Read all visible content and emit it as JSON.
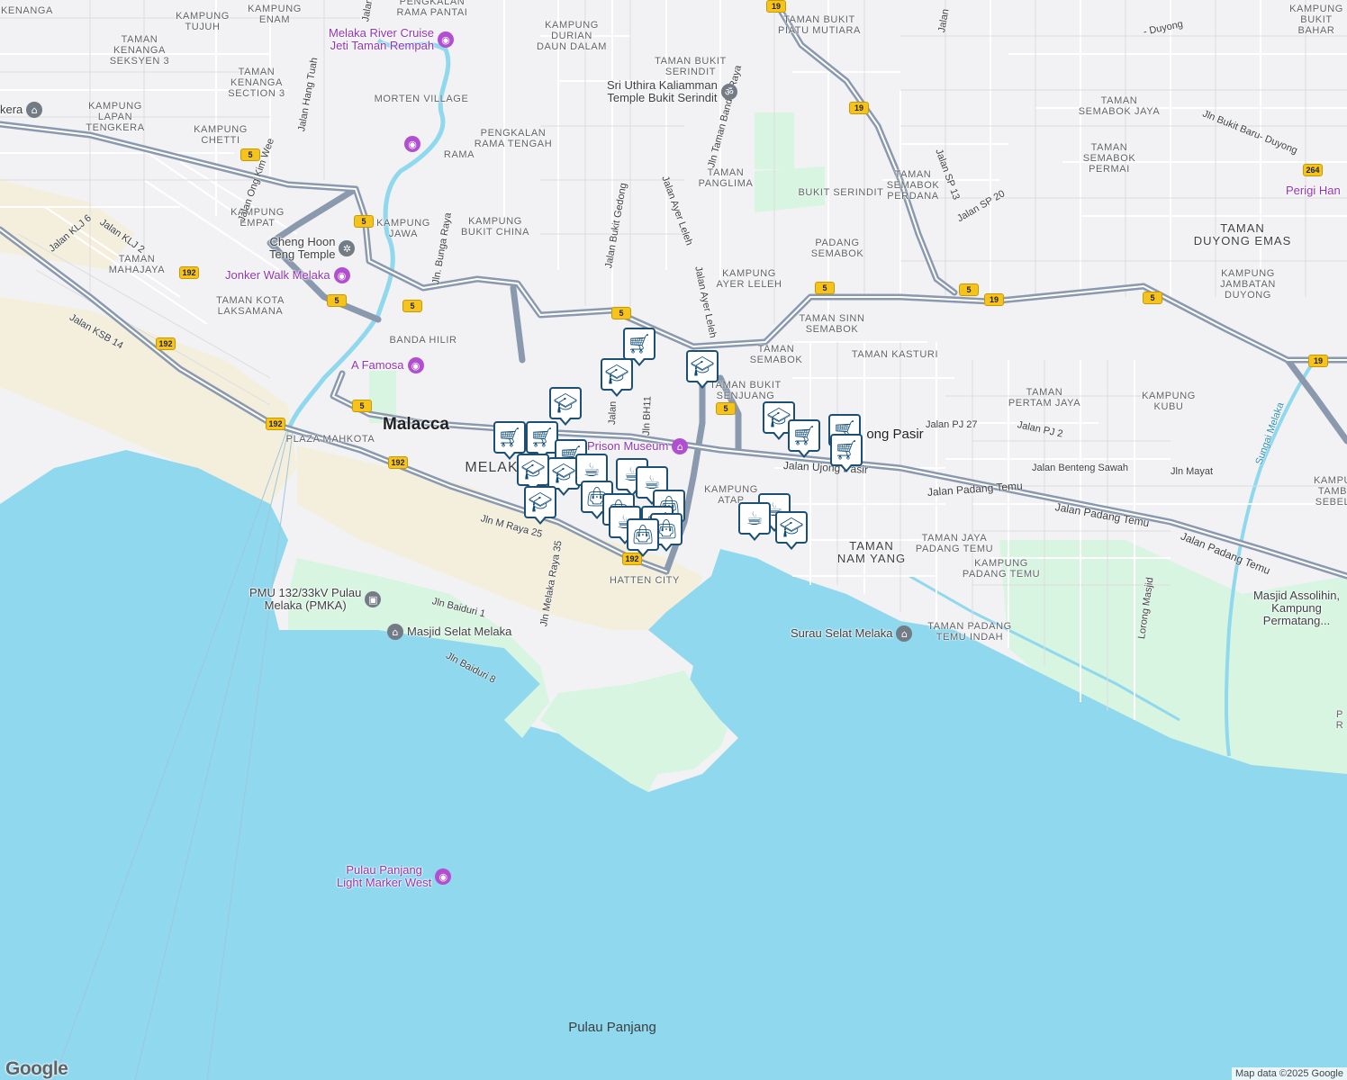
{
  "colors": {
    "water": "#8fd8ee",
    "land": "#f2f2f4",
    "park": "#d8f5e1",
    "sand": "#f4efdd",
    "highway": "#8a99ae",
    "marker_border": "#1d4f73",
    "marker_icon": "#0d4a75",
    "poi_purple": "#9334b6"
  },
  "labels": [
    {
      "id": "kenanga",
      "text": "KENANGA"
    },
    {
      "id": "kampung-tujuh",
      "text": "KAMPUNG\nTUJUH"
    },
    {
      "id": "kampung-enam",
      "text": "KAMPUNG\nENAM"
    },
    {
      "id": "pengkalan-rama-pantai",
      "text": "PENGKALAN\nRAMA PANTAI"
    },
    {
      "id": "taman-kenanga-seksyen-3",
      "text": "TAMAN\nKENANGA\nSEKSYEN 3"
    },
    {
      "id": "taman-kenanga-section-3",
      "text": "TAMAN\nKENANGA\nSECTION 3"
    },
    {
      "id": "kampung-durian-daun-dalam",
      "text": "KAMPUNG\nDURIAN\nDAUN DALAM"
    },
    {
      "id": "taman-bukit-piatu-mutiara",
      "text": "TAMAN BUKIT\nPIATU MUTIARA"
    },
    {
      "id": "kampung-bukit-baharu",
      "text": "KAMPUNG\nBUKIT BAHAR"
    },
    {
      "id": "taman-bukit-serindit",
      "text": "TAMAN BUKIT\nSERINDIT"
    },
    {
      "id": "morten-village",
      "text": "MORTEN VILLAGE"
    },
    {
      "id": "kampung-lapan-tengkera",
      "text": "KAMPUNG\nLAPAN\nTENGKERA"
    },
    {
      "id": "pengkalan-rama-tengah",
      "text": "PENGKALAN\nRAMA TENGAH"
    },
    {
      "id": "rama",
      "text": "RAMA"
    },
    {
      "id": "kampung-chetti",
      "text": "KAMPUNG\nCHETTI"
    },
    {
      "id": "taman-semabok-jaya",
      "text": "TAMAN\nSEMABOK JAYA"
    },
    {
      "id": "taman-semabok-permai",
      "text": "TAMAN\nSEMABOK\nPERMAI"
    },
    {
      "id": "taman-panglima",
      "text": "TAMAN\nPANGLIMA"
    },
    {
      "id": "bukit-serindit",
      "text": "BUKIT SERINDIT"
    },
    {
      "id": "taman-semabok-perdana",
      "text": "TAMAN\nSEMABOK\nPERDANA"
    },
    {
      "id": "kampung-empat",
      "text": "KAMPUNG\nEMPAT"
    },
    {
      "id": "kampung-jawa",
      "text": "KAMPUNG\nJAWA"
    },
    {
      "id": "kampung-bukit-china",
      "text": "KAMPUNG\nBUKIT CHINA"
    },
    {
      "id": "taman-duyong-emas",
      "text": "TAMAN\nDUYONG EMAS"
    },
    {
      "id": "padang-semabok",
      "text": "PADANG\nSEMABOK"
    },
    {
      "id": "taman-mahajaya",
      "text": "TAMAN\nMAHAJAYA"
    },
    {
      "id": "taman-kota-laksamana",
      "text": "TAMAN KOTA\nLAKSAMANA"
    },
    {
      "id": "kampung-ayer-leleh",
      "text": "KAMPUNG\nAYER LELEH"
    },
    {
      "id": "kampung-jambatan-duyong",
      "text": "KAMPUNG\nJAMBATAN\nDUYONG"
    },
    {
      "id": "taman-sinn-semabok",
      "text": "TAMAN SINN\nSEMABOK"
    },
    {
      "id": "banda-hilir",
      "text": "BANDA HILIR"
    },
    {
      "id": "taman-semabok",
      "text": "TAMAN\nSEMABOK"
    },
    {
      "id": "taman-kasturi",
      "text": "TAMAN KASTURI"
    },
    {
      "id": "taman-bukit-senjuang",
      "text": "TAMAN BUKIT\nSENJUANG"
    },
    {
      "id": "taman-pertam-jaya",
      "text": "TAMAN\nPERTAM JAYA"
    },
    {
      "id": "kampung-kubu",
      "text": "KAMPUNG\nKUBU"
    },
    {
      "id": "plaza-mahkota",
      "text": "PLAZA MAHKOTA"
    },
    {
      "id": "kampung-atap",
      "text": "KAMPUNG\nATAP"
    },
    {
      "id": "kampung-tambak-sebelah",
      "text": "KAMPU\nTAMB\nSEBEL"
    },
    {
      "id": "taman-jaya-padang-temu",
      "text": "TAMAN JAYA\nPADANG TEMU"
    },
    {
      "id": "kampung-padang-temu",
      "text": "KAMPUNG\nPADANG TEMU"
    },
    {
      "id": "hatten-city",
      "text": "HATTEN CITY"
    },
    {
      "id": "taman-padang-temu-indah",
      "text": "TAMAN PADANG\nTEMU INDAH"
    },
    {
      "id": "pr-edge",
      "text": "P\nR"
    }
  ],
  "area_labels": [
    {
      "id": "taman-nam-yang",
      "text": "TAMAN\nNAM YANG"
    },
    {
      "id": "melaka",
      "text": "MELAK"
    }
  ],
  "city_labels": [
    {
      "id": "malacca",
      "text": "Malacca"
    },
    {
      "id": "ujong-pasir",
      "text": "ong Pasir"
    }
  ],
  "island_labels": [
    {
      "id": "pulau-panjang",
      "text": "Pulau Panjang"
    }
  ],
  "streets": [
    {
      "id": "jalan-hang-tuah",
      "text": "Jalan Hang Tuah"
    },
    {
      "id": "jalan-ong-kim-wee",
      "text": "Jalan Ong Kim Wee"
    },
    {
      "id": "jalan-klj-6",
      "text": "Jalan KLJ 6"
    },
    {
      "id": "jalan-klj-2",
      "text": "Jalan KLJ 2"
    },
    {
      "id": "jalan-ksb-14",
      "text": "Jalan KSB 14"
    },
    {
      "id": "jln-bunga-raya",
      "text": "Jln. Bunga Raya"
    },
    {
      "id": "jalan-bukit-gedong",
      "text": "Jalan Bukit Gedong"
    },
    {
      "id": "jalan-ayer-leleh-1",
      "text": "Jalan Ayer Leleh"
    },
    {
      "id": "jalan-ayer-leleh-2",
      "text": "Jalan Ayer Leleh"
    },
    {
      "id": "jln-taman-bandar-raya",
      "text": "Jln Taman Bandar Raya"
    },
    {
      "id": "jalan-sp-13",
      "text": "Jalan SP 13"
    },
    {
      "id": "jalan-sp-20",
      "text": "Jalan SP 20"
    },
    {
      "id": "jln-bukit-baru-duyong",
      "text": "Jln Bukit Baru- Duyong"
    },
    {
      "id": "duyong-top",
      "text": "- Duyong"
    },
    {
      "id": "jalan-top",
      "text": "Jalan"
    },
    {
      "id": "jalan-top-left",
      "text": "Jalan"
    },
    {
      "id": "jalan-pj-27",
      "text": "Jalan PJ 27"
    },
    {
      "id": "jalan-pj-2",
      "text": "Jalan PJ 2"
    },
    {
      "id": "jalan-benteng-sawah",
      "text": "Jalan Benteng Sawah"
    },
    {
      "id": "jln-mayat",
      "text": "Jln Mayat"
    },
    {
      "id": "jalan-ujong-pasir",
      "text": "Jalan Ujong Pasir"
    },
    {
      "id": "jalan-padang-temu-1",
      "text": "Jalan Padang Temu"
    },
    {
      "id": "jalan-padang-temu-2",
      "text": "Jalan Padang Temu"
    },
    {
      "id": "jalan-padang-temu-3",
      "text": "Jalan Padang Temu"
    },
    {
      "id": "jln-bh11",
      "text": "Jln BH11"
    },
    {
      "id": "jalan-mid",
      "text": "Jalan"
    },
    {
      "id": "jln-m-raya-25",
      "text": "Jln M Raya 25"
    },
    {
      "id": "jln-melaka-raya-35",
      "text": "Jln Melaka Raya 35"
    },
    {
      "id": "jln-baiduri-1",
      "text": "Jln Baiduri 1"
    },
    {
      "id": "jln-baiduri-8",
      "text": "Jln Baiduri 8"
    },
    {
      "id": "lorong-masjid",
      "text": "Lorong Masjid"
    },
    {
      "id": "sungai-melaka",
      "text": "Sungai Melaka"
    }
  ],
  "pois": [
    {
      "id": "melaka-river-cruise",
      "text": "Melaka River Cruise\nJeti Taman Rempah",
      "icon": "camera-icon",
      "style": "purple"
    },
    {
      "id": "pengkalan-rama-poi",
      "text": "",
      "icon": "camera-icon",
      "style": "purple"
    },
    {
      "id": "cheng-hoon-teng",
      "text": "Cheng Hoon\nTeng Temple",
      "icon": "temple-icon",
      "style": "gray"
    },
    {
      "id": "jonker-walk",
      "text": "Jonker Walk Melaka",
      "icon": "camera-icon",
      "style": "purple"
    },
    {
      "id": "a-famosa",
      "text": "A Famosa",
      "icon": "camera-icon",
      "style": "purple"
    },
    {
      "id": "prison-museum",
      "text": "Prison Museum",
      "icon": "museum-icon",
      "style": "purple"
    },
    {
      "id": "sri-uthira",
      "text": "Sri Uthira Kaliamman\nTemple Bukit Serindit",
      "icon": "om-icon",
      "style": "gray"
    },
    {
      "id": "perigi-hang",
      "text": "Perigi Han",
      "icon": "camera-icon",
      "style": "purple"
    },
    {
      "id": "tengkera-poi",
      "text": "kera",
      "icon": "mosque-icon",
      "style": "gray"
    },
    {
      "id": "pmu-pulau-melaka",
      "text": "PMU 132/33kV Pulau\nMelaka (PMKA)",
      "icon": "building-icon",
      "style": "gray"
    },
    {
      "id": "masjid-selat-melaka",
      "text": "Masjid Selat Melaka",
      "icon": "mosque-icon",
      "style": "gray"
    },
    {
      "id": "surau-selat-melaka",
      "text": "Surau Selat Melaka",
      "icon": "mosque-icon",
      "style": "gray"
    },
    {
      "id": "masjid-assolihin",
      "text": "Masjid Assolihin,\nKampung Permatang...",
      "icon": "",
      "style": "gray"
    },
    {
      "id": "pulau-panjang-light",
      "text": "Pulau Panjang\nLight Marker West",
      "icon": "camera-icon",
      "style": "purple"
    }
  ],
  "route_shields": [
    "5",
    "5",
    "5",
    "5",
    "5",
    "5",
    "5",
    "5",
    "5",
    "5",
    "192",
    "192",
    "192",
    "192",
    "192",
    "19",
    "19",
    "19",
    "19",
    "264"
  ],
  "markers": [
    {
      "id": "m1",
      "type": "grocery-cart-icon"
    },
    {
      "id": "m2",
      "type": "school-icon"
    },
    {
      "id": "m3",
      "type": "school-icon"
    },
    {
      "id": "m4",
      "type": "school-icon"
    },
    {
      "id": "m5",
      "type": "grocery-cart-icon"
    },
    {
      "id": "m6",
      "type": "grocery-cart-icon"
    },
    {
      "id": "m7",
      "type": "grocery-cart-icon"
    },
    {
      "id": "m8",
      "type": "school-icon"
    },
    {
      "id": "m9",
      "type": "school-icon"
    },
    {
      "id": "m10",
      "type": "coffee-cup-icon"
    },
    {
      "id": "m11",
      "type": "school-icon"
    },
    {
      "id": "m12",
      "type": "shopping-bag-icon"
    },
    {
      "id": "m13",
      "type": "coffee-cup-icon"
    },
    {
      "id": "m14",
      "type": "coffee-cup-icon"
    },
    {
      "id": "m15",
      "type": "shopping-bag-icon"
    },
    {
      "id": "m16",
      "type": "shopping-bag-icon"
    },
    {
      "id": "m17",
      "type": "grocery-cart-icon"
    },
    {
      "id": "m18",
      "type": "coffee-cup-icon"
    },
    {
      "id": "m19",
      "type": "shopping-bag-icon"
    },
    {
      "id": "m20",
      "type": "shopping-bag-icon"
    },
    {
      "id": "m21",
      "type": "school-icon"
    },
    {
      "id": "m22",
      "type": "grocery-cart-icon"
    },
    {
      "id": "m23",
      "type": "grocery-cart-icon"
    },
    {
      "id": "m24",
      "type": "grocery-cart-icon"
    },
    {
      "id": "m25",
      "type": "coffee-cup-icon"
    },
    {
      "id": "m26",
      "type": "coffee-cup-icon"
    },
    {
      "id": "m27",
      "type": "school-icon"
    }
  ],
  "attribution": "Map data ©2025 Google",
  "logo": "Google"
}
